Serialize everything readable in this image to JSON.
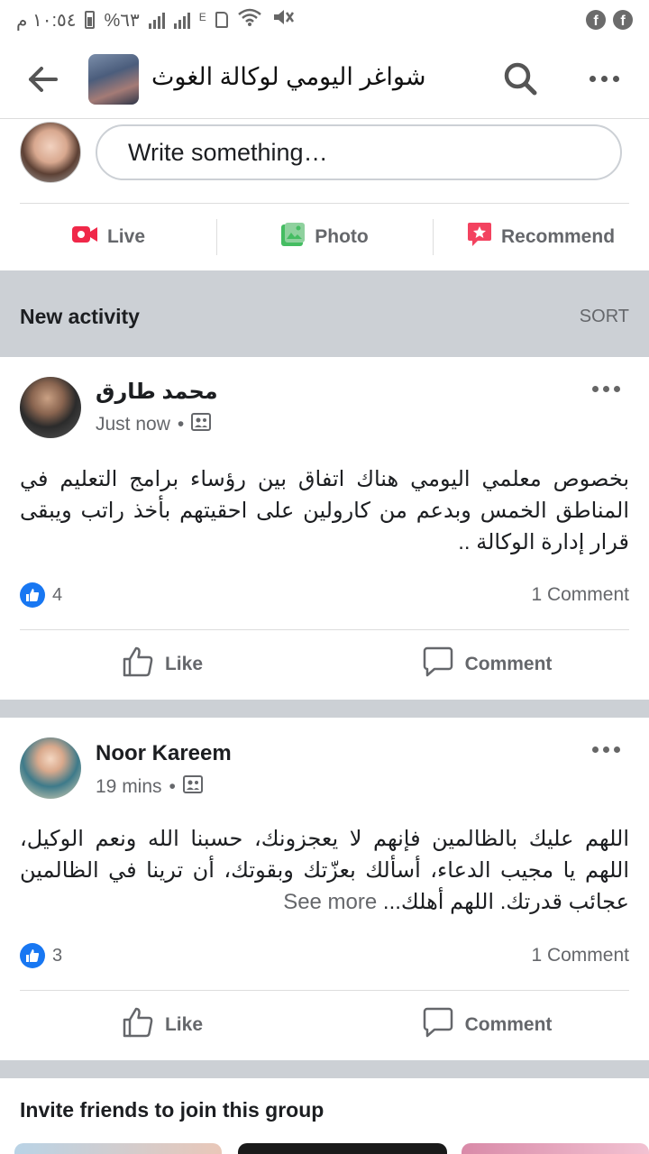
{
  "status_bar": {
    "time": "١٠:٥٤ م",
    "battery": "%٦٣",
    "network": "E"
  },
  "header": {
    "group_title": "شواغر اليومي لوكالة الغوث"
  },
  "composer": {
    "placeholder": "Write something…"
  },
  "composer_actions": {
    "live": "Live",
    "photo": "Photo",
    "recommend": "Recommend"
  },
  "activity": {
    "title": "New activity",
    "sort": "SORT"
  },
  "posts": [
    {
      "author": "محمد طارق",
      "time": "Just now",
      "text": "بخصوص معلمي اليومي هناك اتفاق بين رؤساء برامج التعليم في المناطق الخمس وبدعم من كارولين على احقيتهم بأخذ راتب ويبقى قرار إدارة الوكالة ..",
      "see_more": "",
      "likes": "4",
      "comments": "1 Comment",
      "like_label": "Like",
      "comment_label": "Comment"
    },
    {
      "author": "Noor Kareem",
      "time": "19 mins",
      "text": "اللهم عليك بالظالمين فإنهم لا يعجزونك، حسبنا الله ونعم الوكيل، اللهم يا مجيب الدعاء، أسألك بعزّتك وبقوتك، أن ترينا في الظالمين عجائب قدرتك. اللهم أهلك...",
      "see_more": "See more",
      "likes": "3",
      "comments": "1 Comment",
      "like_label": "Like",
      "comment_label": "Comment"
    }
  ],
  "invite": {
    "title": "Invite friends to join this group"
  },
  "colors": {
    "live_red": "#f02849",
    "photo_green": "#45bd62",
    "recommend_red": "#f3425f",
    "like_blue": "#1877f2",
    "section_gray": "#ccd0d5"
  }
}
